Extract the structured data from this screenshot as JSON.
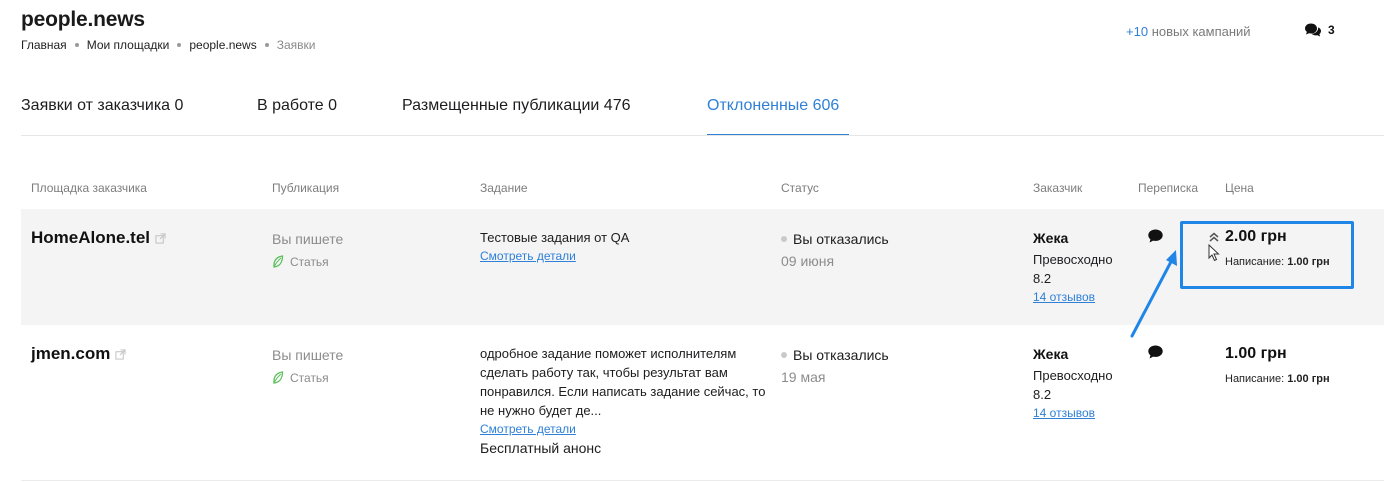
{
  "header": {
    "site_title": "people.news",
    "breadcrumb": [
      "Главная",
      "Мои площадки",
      "people.news",
      "Заявки"
    ],
    "new_campaigns_count": "+10",
    "new_campaigns_label": "новых кампаний",
    "messages_count": "3"
  },
  "tabs": [
    {
      "label": "Заявки от заказчика 0",
      "active": false
    },
    {
      "label": "В работе 0",
      "active": false
    },
    {
      "label": "Размещенные публикации 476",
      "active": false
    },
    {
      "label": "Отклоненные 606",
      "active": true
    }
  ],
  "table": {
    "columns": [
      "Площадка заказчика",
      "Публикация",
      "Задание",
      "Статус",
      "Заказчик",
      "Переписка",
      "Цена"
    ],
    "rows": [
      {
        "platform": "HomeAlone.tel",
        "publication": "Вы пишете",
        "publication_type": "Статья",
        "task_text": "Тестовые задания от QA",
        "task_link": "Смотреть детали",
        "task_extra": "",
        "status": "Вы отказались",
        "status_date": "09 июня",
        "customer_name": "Жека",
        "customer_rating_label": "Превосходно",
        "customer_rating_value": "8.2",
        "customer_reviews": "14 отзывов",
        "price": "2.00 грн",
        "price_detail_label": "Написание:",
        "price_detail_value": "1.00 грн"
      },
      {
        "platform": "jmen.com",
        "publication": "Вы пишете",
        "publication_type": "Статья",
        "task_text": "одробное задание поможет исполнителям сделать работу так, чтобы результат вам понравился. Если написать задание сейчас, то не нужно будет де...",
        "task_link": "Смотреть детали",
        "task_extra": "Бесплатный анонс",
        "status": "Вы отказались",
        "status_date": "19 мая",
        "customer_name": "Жека",
        "customer_rating_label": "Превосходно",
        "customer_rating_value": "8.2",
        "customer_reviews": "14 отзывов",
        "price": "1.00 грн",
        "price_detail_label": "Написание:",
        "price_detail_value": "1.00 грн"
      }
    ]
  },
  "colors": {
    "accent": "#2f80d6",
    "highlight": "#1f86e8",
    "row_hover_bg": "#f4f4f5",
    "leaf_green": "#5bbf5b"
  },
  "icons": {
    "messages": "chat-bubbles-icon",
    "external_link": "external-link-icon",
    "article": "leaf-icon",
    "chat": "chat-bubble-icon",
    "raise_price": "double-chevron-up-icon",
    "cursor": "mouse-cursor-icon"
  }
}
